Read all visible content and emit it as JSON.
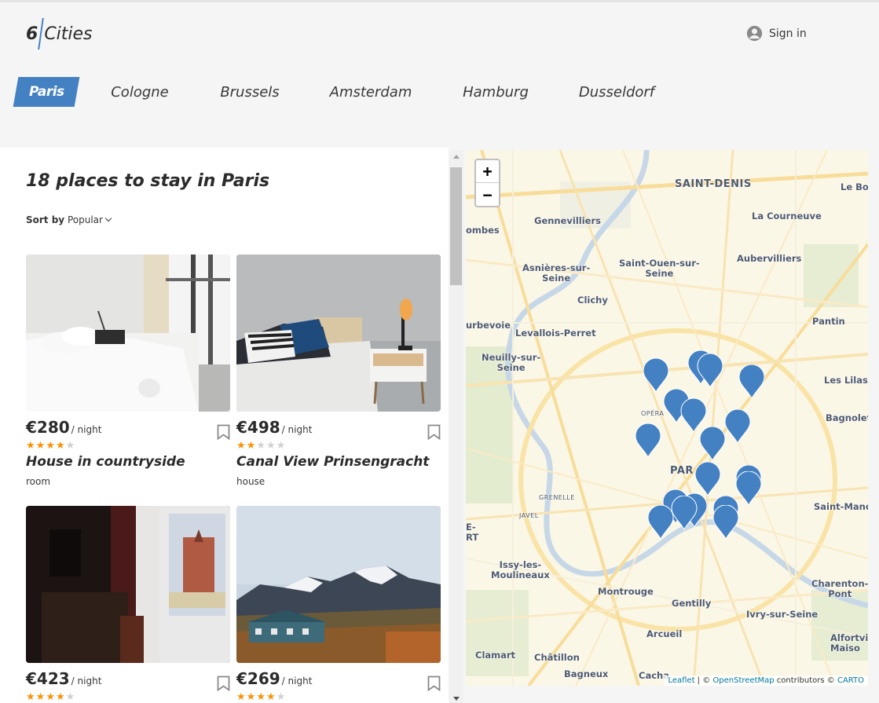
{
  "header": {
    "logo_number": "6",
    "logo_word": "Cities",
    "signin_label": "Sign in"
  },
  "tabs": [
    {
      "label": "Paris",
      "active": true
    },
    {
      "label": "Cologne",
      "active": false
    },
    {
      "label": "Brussels",
      "active": false
    },
    {
      "label": "Amsterdam",
      "active": false
    },
    {
      "label": "Hamburg",
      "active": false
    },
    {
      "label": "Dusseldorf",
      "active": false
    }
  ],
  "list": {
    "title": "18 places to stay in Paris",
    "sort_label": "Sort by",
    "sort_value": "Popular"
  },
  "cards": [
    {
      "price": "€280",
      "unit": "/ night",
      "rating": 4,
      "name": "House in countryside",
      "type": "room"
    },
    {
      "price": "€498",
      "unit": "/ night",
      "rating": 2,
      "name": "Canal View Prinsengracht",
      "type": "house"
    },
    {
      "price": "€423",
      "unit": "/ night",
      "rating": 4,
      "name": "",
      "type": ""
    },
    {
      "price": "€269",
      "unit": "/ night",
      "rating": 4,
      "name": "",
      "type": ""
    }
  ],
  "map": {
    "zoom_in": "+",
    "zoom_out": "−",
    "labels": {
      "saint_denis": "SAINT-DENIS",
      "le_bo": "Le Bo",
      "gennevilliers": "Gennevilliers",
      "la_courneuve": "La Courneuve",
      "ombes": "ombes",
      "asnieres": "Asnières-sur-\nSeine",
      "saint_ouen": "Saint-Ouen-sur-\nSeine",
      "aubervilliers": "Aubervilliers",
      "clichy": "Clichy",
      "urbevoie": "urbevoie",
      "levallois": "Levallois-Perret",
      "pantin": "Pantin",
      "neuilly": "Neuilly-sur-\nSeine",
      "les_lilas": "Les Lilas",
      "opera": "OPÉRA",
      "bagnolet": "Bagnolet",
      "paris": "PAR",
      "grenelle": "GRENELLE",
      "javel": "JAVEL",
      "saint_mand": "Saint-Mand",
      "e_rt": "E-\nRT",
      "issy": "Issy-les-\nMoulineaux",
      "charenton": "Charenton-\nPont",
      "montrouge": "Montrouge",
      "gentilly": "Gentilly",
      "ivry": "Ivry-sur-Seine",
      "arcueil": "Arcueil",
      "alfortvil": "Alfortvil\nMaiso",
      "clamart": "Clamart",
      "chatillon": "Châtillon",
      "bagneux": "Bagneux",
      "cacha": "Cacha"
    },
    "attribution": {
      "leaflet": "Leaflet",
      "sep": " | © ",
      "osm": "OpenStreetMap",
      "contributors": " contributors © ",
      "carto": "CARTO"
    }
  },
  "colors": {
    "accent": "#4481c3",
    "star": "#ff9000",
    "star_empty": "#d0d0d0",
    "background": "#f5f5f5"
  },
  "icons": {
    "signin": "user-avatar-icon",
    "bookmark": "bookmark-icon",
    "pin": "map-pin-icon"
  }
}
